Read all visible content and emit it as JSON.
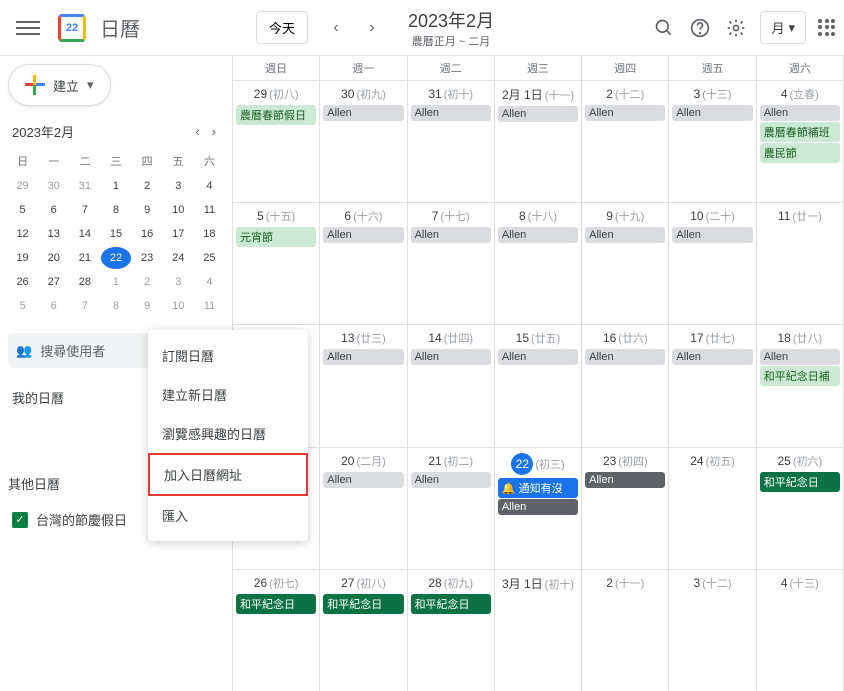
{
  "header": {
    "app_title": "日曆",
    "logo_day": "22",
    "today_btn": "今天",
    "period_main": "2023年2月",
    "period_sub": "農曆正月 ~ 二月",
    "view_label": "月"
  },
  "sidebar": {
    "create_label": "建立",
    "mini_title": "2023年2月",
    "dow": [
      "日",
      "一",
      "二",
      "三",
      "四",
      "五",
      "六"
    ],
    "days": [
      {
        "n": "29",
        "o": true
      },
      {
        "n": "30",
        "o": true
      },
      {
        "n": "31",
        "o": true
      },
      {
        "n": "1"
      },
      {
        "n": "2"
      },
      {
        "n": "3"
      },
      {
        "n": "4"
      },
      {
        "n": "5"
      },
      {
        "n": "6"
      },
      {
        "n": "7"
      },
      {
        "n": "8"
      },
      {
        "n": "9"
      },
      {
        "n": "10"
      },
      {
        "n": "11"
      },
      {
        "n": "12"
      },
      {
        "n": "13"
      },
      {
        "n": "14"
      },
      {
        "n": "15"
      },
      {
        "n": "16"
      },
      {
        "n": "17"
      },
      {
        "n": "18"
      },
      {
        "n": "19"
      },
      {
        "n": "20"
      },
      {
        "n": "21"
      },
      {
        "n": "22",
        "t": true
      },
      {
        "n": "23"
      },
      {
        "n": "24"
      },
      {
        "n": "25"
      },
      {
        "n": "26"
      },
      {
        "n": "27"
      },
      {
        "n": "28"
      },
      {
        "n": "1",
        "o": true
      },
      {
        "n": "2",
        "o": true
      },
      {
        "n": "3",
        "o": true
      },
      {
        "n": "4",
        "o": true
      },
      {
        "n": "5",
        "o": true
      },
      {
        "n": "6",
        "o": true
      },
      {
        "n": "7",
        "o": true
      },
      {
        "n": "8",
        "o": true
      },
      {
        "n": "9",
        "o": true
      },
      {
        "n": "10",
        "o": true
      },
      {
        "n": "11",
        "o": true
      }
    ],
    "search_placeholder": "搜尋使用者",
    "my_calendars": "我的日曆",
    "other_calendars": "其他日曆",
    "taiwan_holidays": "台灣的節慶假日"
  },
  "menu": {
    "subscribe": "訂閱日曆",
    "create_new": "建立新日曆",
    "browse": "瀏覽感興趣的日曆",
    "add_url": "加入日曆網址",
    "import": "匯入"
  },
  "grid": {
    "dow": [
      "週日",
      "週一",
      "週二",
      "週三",
      "週四",
      "週五",
      "週六"
    ],
    "weeks": [
      [
        {
          "num": "29",
          "lunar": "(初八)",
          "events": [
            {
              "t": "農曆春節假日",
              "c": "green"
            }
          ]
        },
        {
          "num": "30",
          "lunar": "(初九)",
          "events": [
            {
              "t": "Allen",
              "c": "gray"
            }
          ]
        },
        {
          "num": "31",
          "lunar": "(初十)",
          "events": [
            {
              "t": "Allen",
              "c": "gray"
            }
          ]
        },
        {
          "num": "2月 1日",
          "lunar": "(十一)",
          "events": [
            {
              "t": "Allen",
              "c": "gray"
            }
          ]
        },
        {
          "num": "2",
          "lunar": "(十二)",
          "events": [
            {
              "t": "Allen",
              "c": "gray"
            }
          ]
        },
        {
          "num": "3",
          "lunar": "(十三)",
          "events": [
            {
              "t": "Allen",
              "c": "gray"
            }
          ]
        },
        {
          "num": "4",
          "lunar": "(立春)",
          "events": [
            {
              "t": "Allen",
              "c": "gray"
            },
            {
              "t": "農曆春節補班",
              "c": "green"
            },
            {
              "t": "農民節",
              "c": "green"
            }
          ]
        }
      ],
      [
        {
          "num": "5",
          "lunar": "(十五)",
          "events": [
            {
              "t": "元宵節",
              "c": "green"
            }
          ]
        },
        {
          "num": "6",
          "lunar": "(十六)",
          "events": [
            {
              "t": "Allen",
              "c": "gray"
            }
          ]
        },
        {
          "num": "7",
          "lunar": "(十七)",
          "events": [
            {
              "t": "Allen",
              "c": "gray"
            }
          ]
        },
        {
          "num": "8",
          "lunar": "(十八)",
          "events": [
            {
              "t": "Allen",
              "c": "gray"
            }
          ]
        },
        {
          "num": "9",
          "lunar": "(十九)",
          "events": [
            {
              "t": "Allen",
              "c": "gray"
            }
          ]
        },
        {
          "num": "10",
          "lunar": "(二十)",
          "events": [
            {
              "t": "Allen",
              "c": "gray"
            }
          ]
        },
        {
          "num": "11",
          "lunar": "(廿一)",
          "events": []
        }
      ],
      [
        {
          "num": "",
          "lunar": "",
          "events": []
        },
        {
          "num": "13",
          "lunar": "(廿三)",
          "events": [
            {
              "t": "Allen",
              "c": "gray"
            }
          ]
        },
        {
          "num": "14",
          "lunar": "(廿四)",
          "events": [
            {
              "t": "Allen",
              "c": "gray"
            }
          ]
        },
        {
          "num": "15",
          "lunar": "(廿五)",
          "events": [
            {
              "t": "Allen",
              "c": "gray"
            }
          ]
        },
        {
          "num": "16",
          "lunar": "(廿六)",
          "events": [
            {
              "t": "Allen",
              "c": "gray"
            }
          ]
        },
        {
          "num": "17",
          "lunar": "(廿七)",
          "events": [
            {
              "t": "Allen",
              "c": "gray"
            }
          ]
        },
        {
          "num": "18",
          "lunar": "(廿八)",
          "events": [
            {
              "t": "Allen",
              "c": "gray"
            },
            {
              "t": "和平紀念日補",
              "c": "green"
            }
          ]
        }
      ],
      [
        {
          "num": "",
          "lunar": "",
          "events": []
        },
        {
          "num": "20",
          "lunar": "(二月)",
          "events": [
            {
              "t": "Allen",
              "c": "gray"
            }
          ]
        },
        {
          "num": "21",
          "lunar": "(初二)",
          "events": [
            {
              "t": "Allen",
              "c": "gray"
            }
          ]
        },
        {
          "num": "22",
          "lunar": "(初三)",
          "today": true,
          "events": [
            {
              "t": "🔔 通知有沒",
              "c": "blue"
            },
            {
              "t": "Allen",
              "c": "dark"
            }
          ]
        },
        {
          "num": "23",
          "lunar": "(初四)",
          "events": [
            {
              "t": "Allen",
              "c": "dark"
            }
          ]
        },
        {
          "num": "24",
          "lunar": "(初五)",
          "events": []
        },
        {
          "num": "25",
          "lunar": "(初六)",
          "events": [
            {
              "t": "和平紀念日",
              "c": "darkgreen"
            }
          ]
        }
      ],
      [
        {
          "num": "26",
          "lunar": "(初七)",
          "events": [
            {
              "t": "和平紀念日",
              "c": "darkgreen"
            }
          ]
        },
        {
          "num": "27",
          "lunar": "(初八)",
          "events": [
            {
              "t": "和平紀念日",
              "c": "darkgreen"
            }
          ]
        },
        {
          "num": "28",
          "lunar": "(初九)",
          "events": [
            {
              "t": "和平紀念日",
              "c": "darkgreen"
            }
          ]
        },
        {
          "num": "3月 1日",
          "lunar": "(初十)",
          "events": []
        },
        {
          "num": "2",
          "lunar": "(十一)",
          "events": []
        },
        {
          "num": "3",
          "lunar": "(十二)",
          "events": []
        },
        {
          "num": "4",
          "lunar": "(十三)",
          "events": []
        }
      ]
    ]
  }
}
